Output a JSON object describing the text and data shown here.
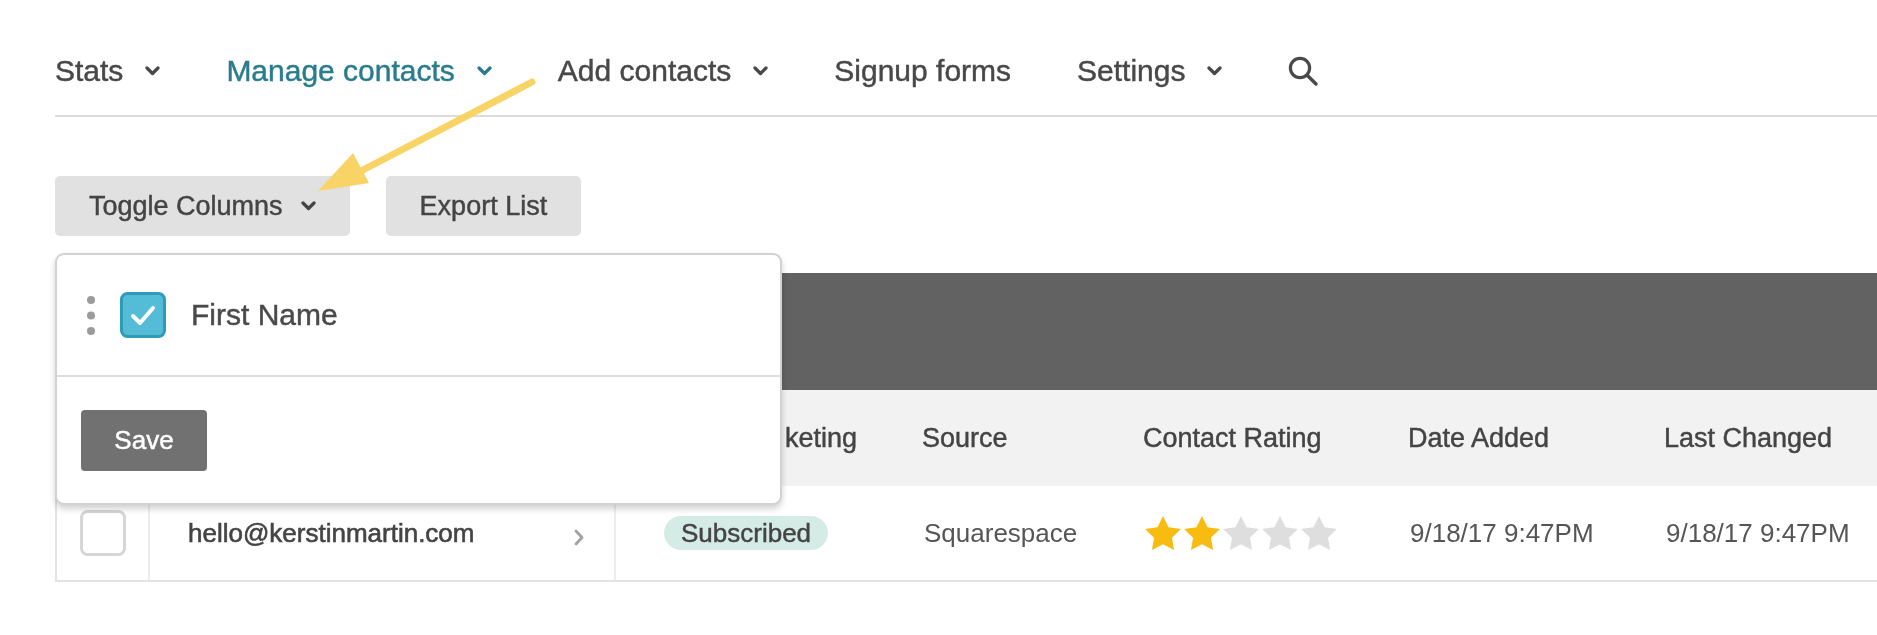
{
  "nav": {
    "items": [
      {
        "label": "Stats",
        "selected": false,
        "has_menu": true
      },
      {
        "label": "Manage contacts",
        "selected": true,
        "has_menu": true
      },
      {
        "label": "Add contacts",
        "selected": false,
        "has_menu": true
      },
      {
        "label": "Signup forms",
        "selected": false,
        "has_menu": false
      },
      {
        "label": "Settings",
        "selected": false,
        "has_menu": true
      }
    ]
  },
  "toolbar": {
    "column_toggle": {
      "label": "Toggle Columns",
      "expanded": true,
      "menu": {
        "items": [
          {
            "label": "First Name",
            "checked": true
          }
        ],
        "save_label": "Save"
      }
    },
    "export_button": {
      "label": "Export List"
    }
  },
  "table": {
    "columns": [
      "keting",
      "Source",
      "Contact Rating",
      "Date Added",
      "Last Changed"
    ],
    "rows": [
      {
        "checked": false,
        "email": "hello@kerstinmartin.com",
        "status": "Subscribed",
        "source": "Squarespace",
        "stars": 2,
        "date_added": "9/18/17 9:47PM",
        "last_changed": "9/18/17 9:47PM"
      }
    ]
  }
}
